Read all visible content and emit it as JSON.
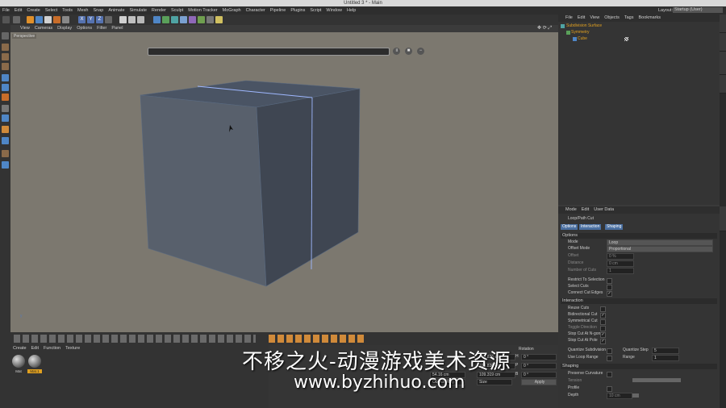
{
  "window": {
    "title": "Untitled 3 * - Main"
  },
  "menu": [
    "File",
    "Edit",
    "Create",
    "Select",
    "Tools",
    "Mesh",
    "Snap",
    "Animate",
    "Simulate",
    "Render",
    "Sculpt",
    "Motion Tracker",
    "MoGraph",
    "Character",
    "Pipeline",
    "Plugins",
    "Script",
    "Window",
    "Help"
  ],
  "layout": {
    "label": "Layout:",
    "value": "Startup (User)"
  },
  "viewport": {
    "menu": [
      "View",
      "Cameras",
      "Display",
      "Options",
      "Filter",
      "Panel"
    ],
    "camera_label": "Perspective"
  },
  "material_manager": {
    "menu": [
      "Create",
      "Edit",
      "Function",
      "Texture"
    ],
    "materials": [
      "Mat",
      "Mat.1"
    ]
  },
  "coordinates": {
    "rotation_header": "Rotation",
    "size_values": [
      "108.836 cm",
      "108.836 cm",
      "109.319 cm"
    ],
    "position_value": "54.16 cm",
    "rot_labels": [
      "H",
      "P",
      "B"
    ],
    "rot_values": [
      "0 °",
      "0 °",
      "0 °"
    ],
    "mode_value": "Object (Rel)",
    "size_mode": "Size",
    "apply_label": "Apply"
  },
  "object_manager": {
    "menu": [
      "File",
      "Edit",
      "View",
      "Objects",
      "Tags",
      "Bookmarks"
    ],
    "objects": [
      "Subdivision Surface",
      "Symmetry",
      "Cube"
    ]
  },
  "attributes": {
    "menu": [
      "Mode",
      "Edit",
      "User Data"
    ],
    "tool_name": "Loop/Path Cut",
    "tabs": [
      "Options",
      "Interaction",
      "Shaping"
    ],
    "options_header": "Options",
    "mode_label": "Mode",
    "mode_value": "Loop",
    "offset_mode_label": "Offset Mode",
    "offset_mode_value": "Proportional",
    "offset_label": "Offset",
    "offset_value": "0 %",
    "distance_label": "Distance",
    "distance_value": "0 cm",
    "cuts_label": "Number of Cuts",
    "cuts_value": "1",
    "restrict_label": "Restrict To Selection",
    "select_cuts_label": "Select Cuts",
    "connect_label": "Connect Cut Edges",
    "interaction_header": "Interaction",
    "reuse_label": "Reuse Cuts",
    "bidirectional_label": "Bidirectional Cut",
    "symmetrical_label": "Symmetrical Cut",
    "toggle_label": "Toggle Direction",
    "stop_ngon_label": "Stop Cut At N-gon",
    "stop_pole_label": "Stop Cut At Pole",
    "quantize_sub_label": "Quantize Subdivision",
    "quantize_step_label": "Quantize Step",
    "quantize_step_value": "5",
    "loop_range_label": "Use Loop Range",
    "range_label": "Range",
    "range_value": "1",
    "shaping_header": "Shaping",
    "preserve_label": "Preserve Curvature",
    "tension_label": "Tension",
    "profile_label": "Profile",
    "depth_label": "Depth",
    "depth_value": "10 cm"
  },
  "watermark": {
    "line1": "不移之火-动漫游戏美术资源",
    "line2": "www.byzhihuo.com"
  }
}
